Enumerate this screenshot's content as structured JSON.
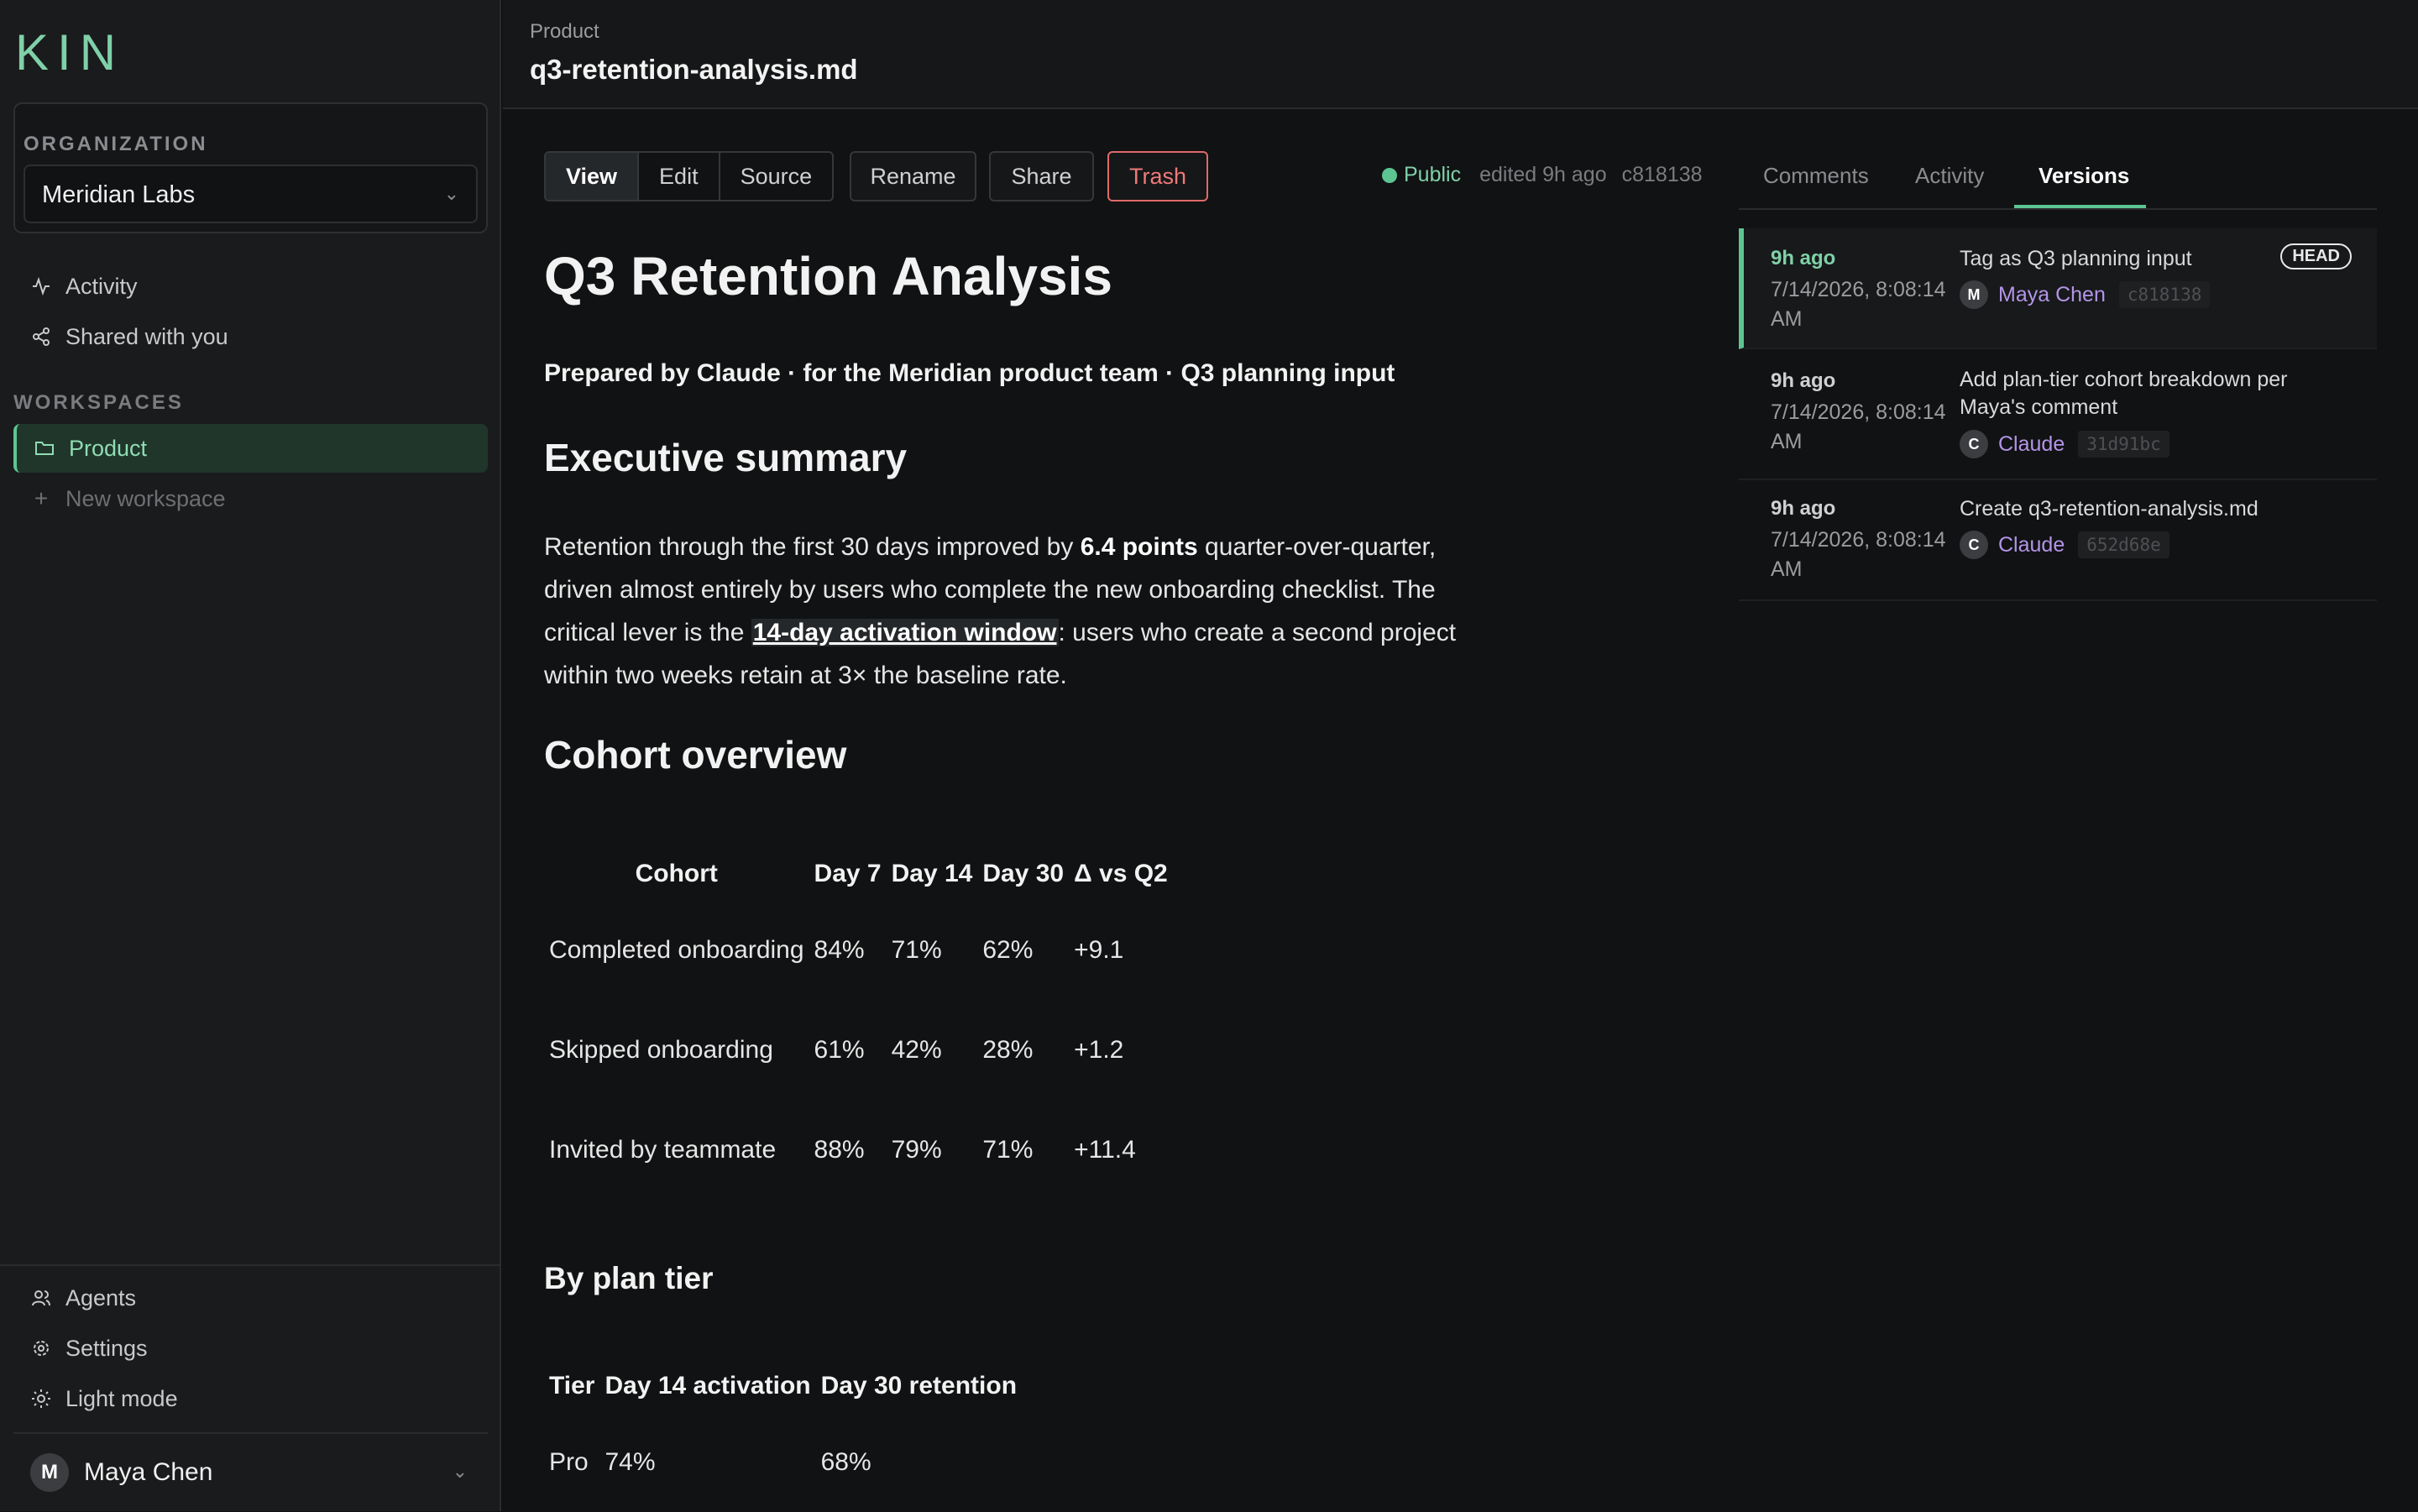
{
  "sidebar": {
    "logo": "KIN",
    "org_label": "ORGANIZATION",
    "org_value": "Meridian Labs",
    "nav": [
      {
        "label": "Activity",
        "icon": "activity-icon"
      },
      {
        "label": "Shared with you",
        "icon": "share-icon"
      }
    ],
    "workspaces_label": "WORKSPACES",
    "workspaces": [
      {
        "label": "Product",
        "icon": "folder-icon",
        "active": true
      }
    ],
    "new_workspace_label": "New workspace",
    "bottom": [
      {
        "label": "Agents",
        "icon": "users-icon"
      },
      {
        "label": "Settings",
        "icon": "gear-icon"
      },
      {
        "label": "Light mode",
        "icon": "sun-icon"
      }
    ],
    "user": {
      "initial": "M",
      "name": "Maya Chen"
    }
  },
  "header": {
    "breadcrumb": "Product",
    "title": "q3-retention-analysis.md"
  },
  "toolbar": {
    "view": "View",
    "edit": "Edit",
    "source": "Source",
    "rename": "Rename",
    "share": "Share",
    "trash": "Trash",
    "visibility": "Public",
    "edited": "edited 9h ago",
    "sha": "c818138"
  },
  "document": {
    "title": "Q3 Retention Analysis",
    "byline": "Prepared by Claude · for the Meridian product team · Q3 planning input",
    "exec_heading": "Executive summary",
    "exec_p1": "Retention through the first 30 days improved by ",
    "exec_bold": "6.4 points",
    "exec_p2": " quarter-over-quarter, driven almost entirely by users who complete the new onboarding checklist. The critical lever is the ",
    "exec_link": "14-day activation window",
    "exec_p3": ": users who create a second project within two weeks retain at 3× the baseline rate.",
    "cohort_heading": "Cohort overview",
    "cohort_table": {
      "headers": [
        "Cohort",
        "Day 7",
        "Day 14",
        "Day 30",
        "Δ vs Q2"
      ],
      "rows": [
        [
          "Completed onboarding",
          "84%",
          "71%",
          "62%",
          "+9.1"
        ],
        [
          "Skipped onboarding",
          "61%",
          "42%",
          "28%",
          "+1.2"
        ],
        [
          "Invited by teammate",
          "88%",
          "79%",
          "71%",
          "+11.4"
        ]
      ]
    },
    "tier_heading": "By plan tier",
    "tier_table": {
      "headers": [
        "Tier",
        "Day 14 activation",
        "Day 30 retention"
      ],
      "rows": [
        [
          "Pro",
          "74%",
          "68%"
        ]
      ]
    }
  },
  "panel": {
    "tabs": [
      "Comments",
      "Activity",
      "Versions"
    ],
    "active_tab": "Versions",
    "versions": [
      {
        "time": "9h ago",
        "date": "7/14/2026, 8:08:14 AM",
        "message": "Tag as Q3 planning input",
        "author_initial": "M",
        "author": "Maya Chen",
        "sha": "c818138",
        "badge": "HEAD"
      },
      {
        "time": "9h ago",
        "date": "7/14/2026, 8:08:14 AM",
        "message": "Add plan-tier cohort breakdown per Maya's comment",
        "author_initial": "C",
        "author": "Claude",
        "sha": "31d91bc"
      },
      {
        "time": "9h ago",
        "date": "7/14/2026, 8:08:14 AM",
        "message": "Create q3-retention-analysis.md",
        "author_initial": "C",
        "author": "Claude",
        "sha": "652d68e"
      }
    ]
  },
  "colors": {
    "accent": "#5cc592",
    "danger": "#e06a6a",
    "author": "#b394e8",
    "background": "#111213"
  }
}
